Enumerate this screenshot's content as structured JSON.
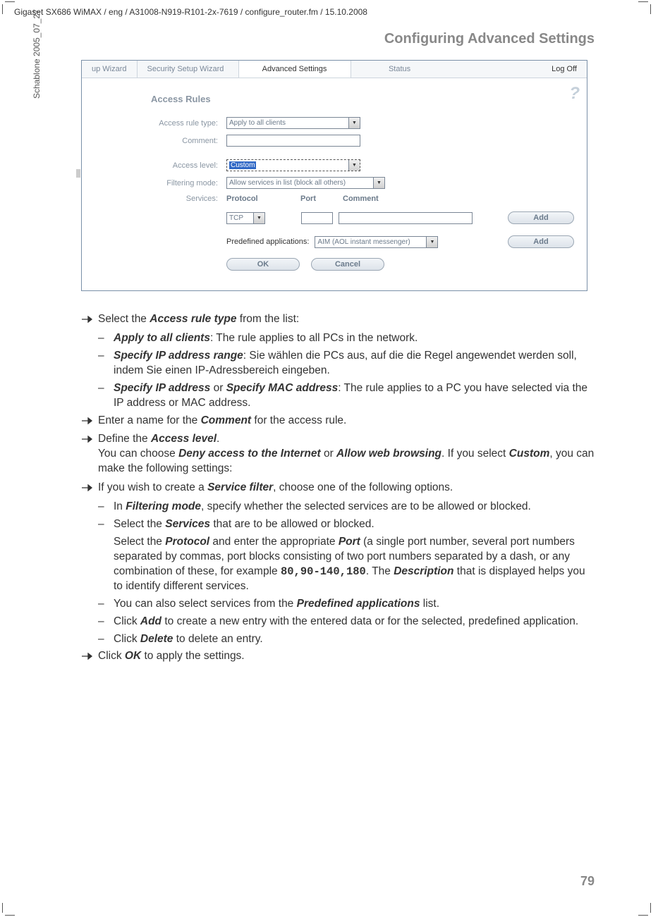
{
  "header_path": "Gigaset SX686 WiMAX / eng / A31008-N919-R101-2x-7619 / configure_router.fm / 15.10.2008",
  "vertical_label": "Schablone 2005_07_27",
  "section_title": "Configuring Advanced Settings",
  "page_number": "79",
  "screenshot": {
    "tabs": [
      "up Wizard",
      "Security Setup Wizard",
      "Advanced Settings",
      "Status"
    ],
    "active_tab_index": 2,
    "logoff": "Log Off",
    "title": "Access Rules",
    "rows": {
      "access_rule_type": {
        "label": "Access rule type:",
        "value": "Apply to all clients"
      },
      "comment": {
        "label": "Comment:",
        "value": ""
      },
      "access_level": {
        "label": "Access level:",
        "value": "Custom"
      },
      "filtering_mode": {
        "label": "Filtering mode:",
        "value": "Allow services in list (block all others)"
      },
      "services_label": "Services:"
    },
    "services_header": {
      "protocol": "Protocol",
      "port": "Port",
      "comment": "Comment"
    },
    "services_row": {
      "protocol": "TCP",
      "port": "",
      "comment": ""
    },
    "predefined_label": "Predefined applications:",
    "predefined_value": "AIM (AOL instant messenger)",
    "buttons": {
      "add": "Add",
      "add2": "Add",
      "ok": "OK",
      "cancel": "Cancel"
    }
  },
  "content": {
    "p1": "Select the ",
    "p1b": "Access rule type",
    "p1c": " from the list:",
    "d1a": "Apply to all clients",
    "d1b": ": The rule applies to all PCs in the network.",
    "d2a": "Specify IP address range",
    "d2b": ": Sie wählen die PCs aus, auf die die Regel angewendet werden soll, indem Sie einen IP-Adressbereich eingeben.",
    "d3a": "Specify IP address",
    "d3or": " or ",
    "d3a2": "Specify MAC address",
    "d3b": ": The rule applies to a PC you have selected via the IP address or MAC address.",
    "p2a": "Enter a name for the ",
    "p2b": "Comment",
    "p2c": " for the access rule.",
    "p3a": "Define the ",
    "p3b": "Access level",
    "p3c": ".",
    "p3d": "You can choose ",
    "p3e": "Deny access to the Internet",
    "p3f": " or ",
    "p3g": "Allow web browsing",
    "p3h": ". If you select ",
    "p3i": "Custom",
    "p3j": ", you can make the following settings:",
    "p4a": "If you wish to create a ",
    "p4b": "Service filter",
    "p4c": ", choose one of the following options.",
    "d4a": "In ",
    "d4b": "Filtering mode",
    "d4c": ", specify whether the selected services are to be allowed or blocked.",
    "d5a": "Select the ",
    "d5b": "Services",
    "d5c": " that are to be allowed or blocked.",
    "d5d": "Select the ",
    "d5e": "Protocol",
    "d5f": " and enter the appropriate ",
    "d5g": "Port",
    "d5h": " (a single port number, several port numbers separated by commas, port blocks consisting of two port numbers separated by a dash, or any combination of these, for example ",
    "d5i": "80,90-140,180",
    "d5j": ". The ",
    "d5k": "Description",
    "d5l": " that is displayed helps you to identify different serv­ices.",
    "d6a": "You can also select services from the ",
    "d6b": "Predefined applications",
    "d6c": " list.",
    "d7a": "Click ",
    "d7b": "Add",
    "d7c": " to create a new entry with the entered data or for the selected, prede­fined application.",
    "d8a": "Click ",
    "d8b": "Delete",
    "d8c": " to delete an entry.",
    "p5a": "Click ",
    "p5b": "OK",
    "p5c": " to apply the settings."
  }
}
